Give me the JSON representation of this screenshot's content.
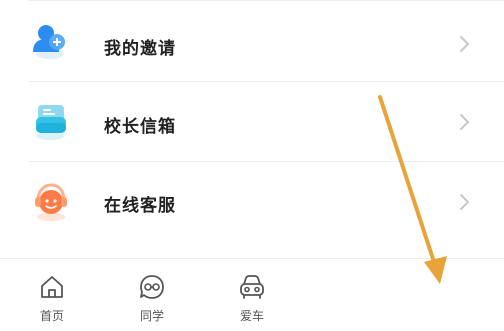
{
  "menu": {
    "items": [
      {
        "label": "我的邀请",
        "icon": "invite-icon"
      },
      {
        "label": "校长信箱",
        "icon": "mailbox-icon"
      },
      {
        "label": "在线客服",
        "icon": "customer-service-icon"
      }
    ]
  },
  "tabbar": {
    "tabs": [
      {
        "label": "首页",
        "icon": "home-icon"
      },
      {
        "label": "同学",
        "icon": "classmates-icon"
      },
      {
        "label": "爱车",
        "icon": "car-icon"
      }
    ]
  },
  "colors": {
    "accent_blue": "#2c8cf0",
    "accent_cyan": "#33c1e6",
    "accent_orange": "#ff7a45",
    "annotation_arrow": "#e8a33a"
  }
}
